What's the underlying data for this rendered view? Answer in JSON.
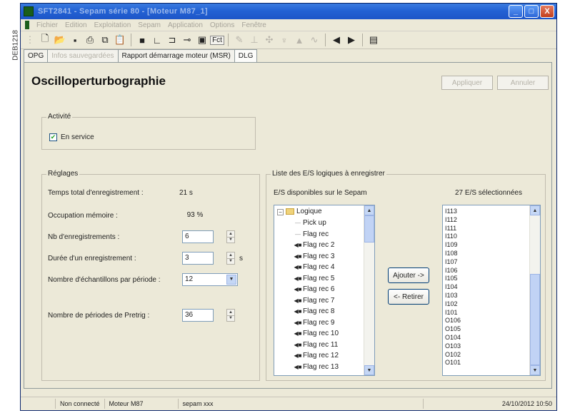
{
  "side_reference": "DEB1218",
  "window": {
    "title": "SFT2841 - Sepam série 80 - [Moteur M87_1]",
    "controls": [
      "_",
      "□",
      "X"
    ]
  },
  "menu": [
    "Fichier",
    "Edition",
    "Exploitation",
    "Sepam",
    "Application",
    "Options",
    "Fenêtre"
  ],
  "toolbar": {
    "fct_label": "Fct",
    "icons": [
      "new-icon",
      "open-icon",
      "save-icon",
      "print-icon",
      "copy-icon",
      "paste-icon",
      "disk-icon",
      "chart-icon",
      "logic-icon",
      "link-icon",
      "screen-icon",
      "fct-button",
      "pen-icon",
      "ground-icon",
      "plus-icon",
      "triangle-icon",
      "wave-icon",
      "arrow-left-icon",
      "arrow-right-icon",
      "document-icon"
    ]
  },
  "tabs": [
    {
      "label": "OPG",
      "state": "normal"
    },
    {
      "label": "Infos sauvegardées",
      "state": "disabled"
    },
    {
      "label": "Rapport démarrage moteur (MSR)",
      "state": "normal"
    },
    {
      "label": "DLG",
      "state": "active"
    }
  ],
  "page": {
    "title": "Oscilloperturbographie",
    "apply_label": "Appliquer",
    "cancel_label": "Annuler"
  },
  "activity": {
    "legend": "Activité",
    "checkbox_label": "En service",
    "checked": true
  },
  "settings": {
    "legend": "Réglages",
    "total_time_label": "Temps total d'enregistrement :",
    "total_time_value": "21 s",
    "memory_label": "Occupation mémoire :",
    "memory_value": "93 %",
    "nb_records_label": "Nb d'enregistrements :",
    "nb_records_value": "6",
    "duration_label": "Durée d'un enregistrement :",
    "duration_value": "3",
    "duration_unit": "s",
    "samples_label": "Nombre d'échantillons par période :",
    "samples_value": "12",
    "pretrig_label": "Nombre de périodes de Pretrig :",
    "pretrig_value": "36"
  },
  "io_list": {
    "legend": "Liste des E/S logiques à enregistrer",
    "available_header": "E/S disponibles sur le Sepam",
    "selected_header": "27 E/S sélectionnées",
    "tree_root": "Logique",
    "available_items": [
      {
        "label": "Pick up",
        "faded": true
      },
      {
        "label": "Flag rec",
        "faded": true
      },
      {
        "label": "Flag rec 2",
        "faded": false
      },
      {
        "label": "Flag rec 3",
        "faded": false
      },
      {
        "label": "Flag rec 4",
        "faded": false
      },
      {
        "label": "Flag rec 5",
        "faded": false
      },
      {
        "label": "Flag rec 6",
        "faded": false
      },
      {
        "label": "Flag rec 7",
        "faded": false
      },
      {
        "label": "Flag rec 8",
        "faded": false
      },
      {
        "label": "Flag rec 9",
        "faded": false
      },
      {
        "label": "Flag rec 10",
        "faded": false
      },
      {
        "label": "Flag rec 11",
        "faded": false
      },
      {
        "label": "Flag rec 12",
        "faded": false
      },
      {
        "label": "Flag rec 13",
        "faded": false
      }
    ],
    "selected_items": [
      "I113",
      "I112",
      "I111",
      "I110",
      "I109",
      "I108",
      "I107",
      "I106",
      "I105",
      "I104",
      "I103",
      "I102",
      "I101",
      "O106",
      "O105",
      "O104",
      "O103",
      "O102",
      "O101"
    ],
    "add_label": "Ajouter ->",
    "remove_label": "<- Retirer"
  },
  "status": {
    "connection": "Non connecté",
    "model": "Moteur M87",
    "file": "sepam xxx",
    "datetime": "24/10/2012 10:50"
  }
}
